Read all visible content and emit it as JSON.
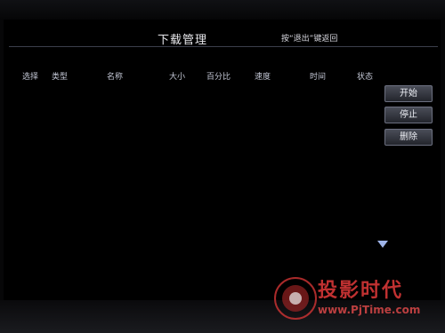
{
  "header": {
    "title": "下载管理",
    "hint": "按“退出”键返回"
  },
  "table": {
    "columns": [
      "选择",
      "类型",
      "名称",
      "大小",
      "百分比",
      "速度",
      "时间",
      "状态"
    ]
  },
  "actions": {
    "start": "开始",
    "stop": "停止",
    "delete": "删除"
  },
  "watermark": {
    "name": "投影时代",
    "url": "www.PjTime.com"
  },
  "colors": {
    "background": "#000000",
    "button": "#3a3d47",
    "text": "#e8e8ec",
    "watermark": "#e23a3a"
  },
  "icons": {
    "scroll_down": "triangle-down-icon"
  }
}
